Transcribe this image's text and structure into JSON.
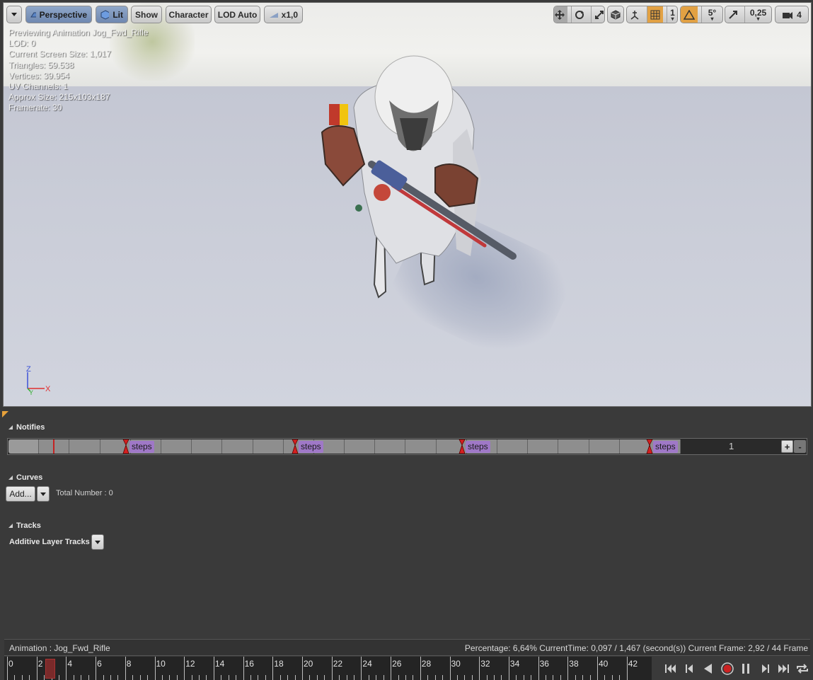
{
  "toolbar": {
    "menu_icon": "chevron-down-icon",
    "perspective": "Perspective",
    "lit": "Lit",
    "show": "Show",
    "character": "Character",
    "lod": "LOD Auto",
    "speed": "x1,0",
    "grid_snap": "1",
    "rotation_snap": "5°",
    "scale_snap": "0,25",
    "camera_speed": "4"
  },
  "stats": {
    "previewing": "Previewing Animation Jog_Fwd_Rifle",
    "lod": "LOD: 0",
    "screen_size": "Current Screen Size: 1,017",
    "triangles": "Triangles: 59.538",
    "vertices": "Vertices: 39.954",
    "uv_channels": "UV Channels: 1",
    "approx_size": "Approx Size: 215x103x187",
    "framerate": "Framerate: 30"
  },
  "axis": {
    "z": "Z",
    "y": "Y",
    "x": "X"
  },
  "notifies": {
    "title": "Notifies",
    "items": [
      "steps",
      "steps",
      "steps",
      "steps"
    ],
    "count": "1",
    "plus": "+",
    "minus": "-"
  },
  "curves": {
    "title": "Curves",
    "add_label": "Add...",
    "total": "Total Number : 0"
  },
  "tracks": {
    "title": "Tracks",
    "additive": "Additive Layer Tracks"
  },
  "status": {
    "animation": "Animation :  Jog_Fwd_Rifle",
    "info": "Percentage:  6,64% CurrentTime:  0,097 / 1,467 (second(s)) Current Frame:  2,92 / 44 Frame"
  },
  "timeline": {
    "ticks": [
      "0",
      "2",
      "4",
      "6",
      "8",
      "10",
      "12",
      "14",
      "16",
      "18",
      "20",
      "22",
      "24",
      "26",
      "28",
      "30",
      "32",
      "34",
      "36",
      "38",
      "40",
      "42"
    ],
    "current_frame": 2.92,
    "total_frames": 44
  },
  "colors": {
    "accent_orange": "#e2a143",
    "notify_purple": "#9f78c7",
    "playhead_red": "#c42222",
    "record_red": "#c22"
  }
}
